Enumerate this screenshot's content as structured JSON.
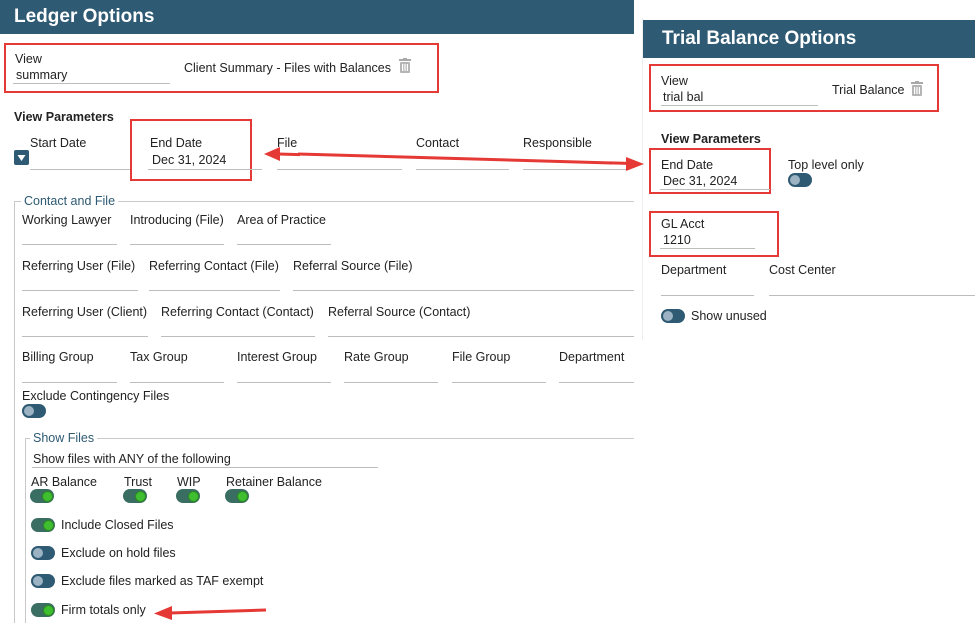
{
  "ledger": {
    "title": "Ledger Options",
    "view_label": "View",
    "view_value": "summary",
    "view_name": "Client Summary - Files with Balances",
    "params_title": "View Parameters",
    "start_date_label": "Start Date",
    "end_date_label": "End Date",
    "end_date_value": "Dec 31, 2024",
    "file_label": "File",
    "contact_label": "Contact",
    "responsible_label": "Responsible",
    "contact_file_legend": "Contact and File",
    "row1": [
      "Working Lawyer",
      "Introducing (File)",
      "Area of Practice"
    ],
    "row2": [
      "Referring User (File)",
      "Referring Contact (File)",
      "Referral Source (File)"
    ],
    "row3": [
      "Referring User (Client)",
      "Referring Contact (Contact)",
      "Referral Source (Contact)"
    ],
    "row4": [
      "Billing Group",
      "Tax Group",
      "Interest Group",
      "Rate Group",
      "File Group",
      "Department"
    ],
    "exclude_contingency": "Exclude Contingency Files",
    "show_files_legend": "Show Files",
    "show_files_select": "Show files with ANY of the following",
    "ar_balance": "AR Balance",
    "trust": "Trust",
    "wip": "WIP",
    "retainer_balance": "Retainer Balance",
    "include_closed": "Include Closed Files",
    "exclude_on_hold": "Exclude on hold files",
    "exclude_taf": "Exclude files marked as TAF exempt",
    "firm_totals": "Firm totals only"
  },
  "trial": {
    "title": "Trial Balance Options",
    "view_label": "View",
    "view_value": "trial bal",
    "view_name": "Trial Balance",
    "params_title": "View Parameters",
    "end_date_label": "End Date",
    "end_date_value": "Dec 31, 2024",
    "top_level_only": "Top level only",
    "gl_acct_label": "GL Acct",
    "gl_acct_value": "1210",
    "department_label": "Department",
    "cost_center_label": "Cost Center",
    "show_unused": "Show unused"
  },
  "colors": {
    "header": "#2e5a73",
    "highlight": "#e53935",
    "toggle_on": "#3fbf2f"
  }
}
